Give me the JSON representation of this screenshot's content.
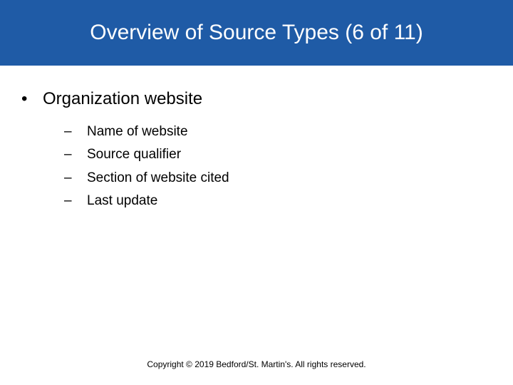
{
  "title": "Overview of Source Types (6 of 11)",
  "level1_text": "Organization website",
  "sub_items": [
    "Name of website",
    "Source qualifier",
    "Section of website cited",
    "Last update"
  ],
  "footer": "Copyright © 2019 Bedford/St. Martin's. All rights reserved."
}
